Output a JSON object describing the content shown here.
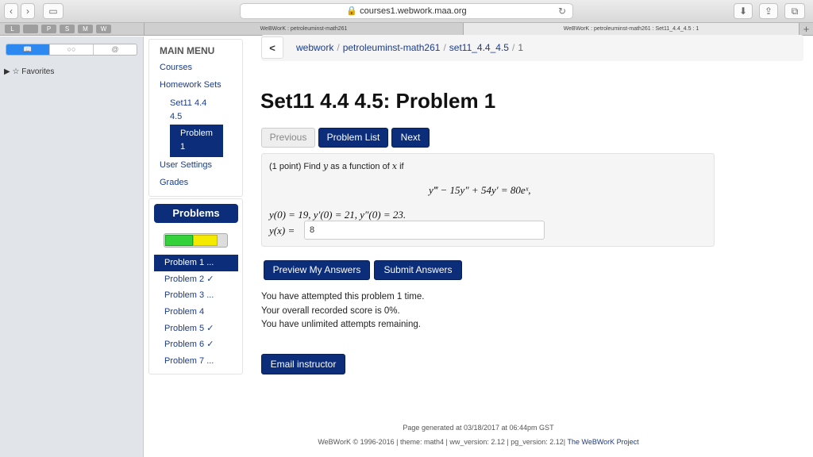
{
  "browser": {
    "url": "courses1.webwork.maa.org",
    "tabs": [
      "WeBWorK : petroleuminst-math261",
      "WeBWorK : petroleuminst-math261 : Set11_4.4_4.5 : 1"
    ],
    "fav_icons": [
      "L",
      "",
      "P",
      "S",
      "M",
      "W"
    ],
    "sidebar_favorites": "Favorites"
  },
  "menu": {
    "title": "MAIN MENU",
    "courses": "Courses",
    "homework_sets": "Homework Sets",
    "set_line1": "Set11 4.4",
    "set_line2": "4.5",
    "problem_line1": "Problem",
    "problem_line2": "1",
    "user_settings": "User Settings",
    "grades": "Grades"
  },
  "problems_panel": {
    "title": "Problems",
    "progress_correct_fraction": 0.44,
    "progress_attempted_fraction": 0.39,
    "items": [
      "Problem 1 ...",
      "Problem 2 ✓",
      "Problem 3 ...",
      "Problem 4",
      "Problem 5 ✓",
      "Problem 6 ✓",
      "Problem 7 ..."
    ]
  },
  "breadcrumb": {
    "back": "<",
    "c1": "webwork",
    "c2": "petroleuminst-math261",
    "c3": "set11_4.4_4.5",
    "c4": "1"
  },
  "page_title": "Set11 4.4 4.5: Problem 1",
  "nav": {
    "previous": "Previous",
    "problem_list": "Problem List",
    "next": "Next"
  },
  "problem": {
    "intro_a": "(1 point) Find",
    "y": "y",
    "intro_b": "as a function of",
    "x": "x",
    "intro_c": "if",
    "equation": "y‴ − 15y″ + 54y′ = 80eˣ,",
    "initial": "y(0) = 19,  y′(0) = 21,  y″(0) = 23.",
    "answer_label": "y(x) =",
    "answer_value": "8"
  },
  "actions": {
    "preview": "Preview My Answers",
    "submit": "Submit Answers",
    "email": "Email instructor"
  },
  "messages": [
    "You have attempted this problem 1 time.",
    "Your overall recorded score is 0%.",
    "You have unlimited attempts remaining."
  ],
  "footer": {
    "generated": "Page generated at 03/18/2017 at 06:44pm GST",
    "line2": "WeBWorK © 1996-2016 | theme: math4 | ww_version: 2.12 | pg_version: 2.12|",
    "project": "The WeBWorK Project"
  }
}
